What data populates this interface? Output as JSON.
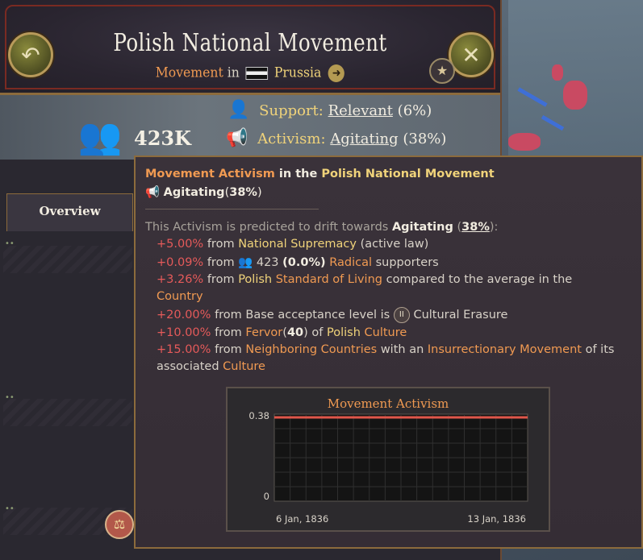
{
  "header": {
    "title": "Polish National Movement",
    "subtitle_prefix": "Movement",
    "subtitle_in": "in",
    "country": "Prussia"
  },
  "icons": {
    "back": "back-arrow-icon",
    "close": "close-icon",
    "star": "star-icon",
    "people": "people-icon",
    "megaphone": "megaphone-icon"
  },
  "info": {
    "population": "423K",
    "support_label": "Support:",
    "support_value": "Relevant",
    "support_pct": "(6%)",
    "activism_label": "Activism:",
    "activism_value": "Agitating",
    "activism_pct": "(38%)"
  },
  "tabs": [
    {
      "label": "Overview"
    }
  ],
  "tooltip": {
    "h1": "Movement Activism",
    "h2": "in the",
    "h3": "Polish National Movement",
    "state_label": "Agitating",
    "state_pct": "38%",
    "drift_prefix": "This Activism is predicted to drift towards",
    "drift_target": "Agitating",
    "drift_pct": "38%",
    "lines": [
      {
        "pct": "+5.00%",
        "from": "from",
        "a": "National Supremacy",
        "b": "(active law)"
      },
      {
        "pct": "+0.09%",
        "from": "from",
        "a": "423",
        "b": "(0.0%)",
        "c": "Radical",
        "d": "supporters"
      },
      {
        "pct": "+3.26%",
        "from": "from",
        "a": "Polish",
        "b": "Standard of Living",
        "c": "compared to the average in the",
        "d": "Country"
      },
      {
        "pct": "+20.00%",
        "from": "from Base acceptance level is",
        "a": "Cultural Erasure"
      },
      {
        "pct": "+10.00%",
        "from": "from",
        "a": "Fervor",
        "b": "40",
        "c": "of",
        "d": "Polish",
        "e": "Culture"
      },
      {
        "pct": "+15.00%",
        "from": "from",
        "a": "Neighboring Countries",
        "b": "with an",
        "c": "Insurrectionary Movement",
        "d": "of its",
        "e": "associated",
        "f": "Culture"
      }
    ]
  },
  "chart_data": {
    "type": "line",
    "title": "Movement Activism",
    "x": [
      "6 Jan, 1836",
      "13 Jan, 1836"
    ],
    "series": [
      {
        "values": [
          0.38,
          0.38
        ]
      }
    ],
    "ylim": [
      0,
      0.38
    ],
    "y_ticks": [
      "0.38",
      "0"
    ],
    "x_ticks": [
      "6 Jan, 1836",
      "13 Jan, 1836"
    ],
    "grid": true,
    "line_color": "#e0564a"
  },
  "colors": {
    "accent_orange": "#f09a52",
    "accent_gold": "#f0d37a",
    "positive_red": "#e55a5a"
  }
}
